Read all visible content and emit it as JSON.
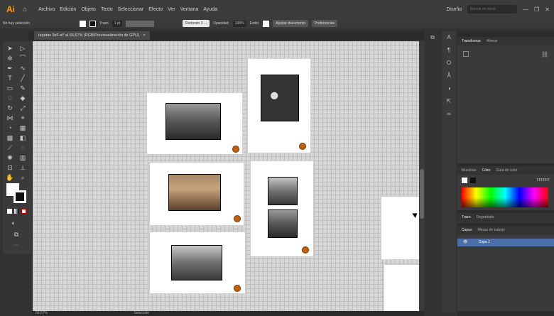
{
  "app": {
    "logo": "Ai"
  },
  "menubar": {
    "items": [
      "Archivo",
      "Edición",
      "Objeto",
      "Texto",
      "Seleccionar",
      "Efecto",
      "Ver",
      "Ventana",
      "Ayuda"
    ],
    "workspace": "Diseño",
    "search_placeholder": "Buscar en stock"
  },
  "control_bar": {
    "selection_label": "No hay selección",
    "stroke_label": "Trazo",
    "stroke_value": "1 pt",
    "brush_label": "Redondo 3 ...",
    "opacity_label": "Opacidad:",
    "opacity_value": "100%",
    "style_label": "Estilo:",
    "doc_setup_button": "Ajustar documento",
    "preferences_button": "Preferencias"
  },
  "document_tab": {
    "title": "tarjetas 9x6.ai* al 66,67% (RGB/Previsualización de GPU)",
    "close": "×"
  },
  "status_bar": {
    "zoom": "66,67%",
    "tool": "Selección"
  },
  "panels": {
    "transform_tabs": [
      "Transformar",
      "Alinear"
    ],
    "color_tabs": [
      "Muestras",
      "Color",
      "Guía de color"
    ],
    "hex_value": "FFFFFF",
    "lower_tabs_1": [
      "Trazo",
      "Degradado"
    ],
    "lower_tabs_2": [
      "Capas",
      "Mesas de trabajo"
    ],
    "layer_name": "Capa 1"
  },
  "icons": {
    "home": "home-icon",
    "search": "search-icon"
  },
  "colors": {
    "accent_orange": "#ff9a00",
    "layer_highlight": "#4b6fa8"
  }
}
